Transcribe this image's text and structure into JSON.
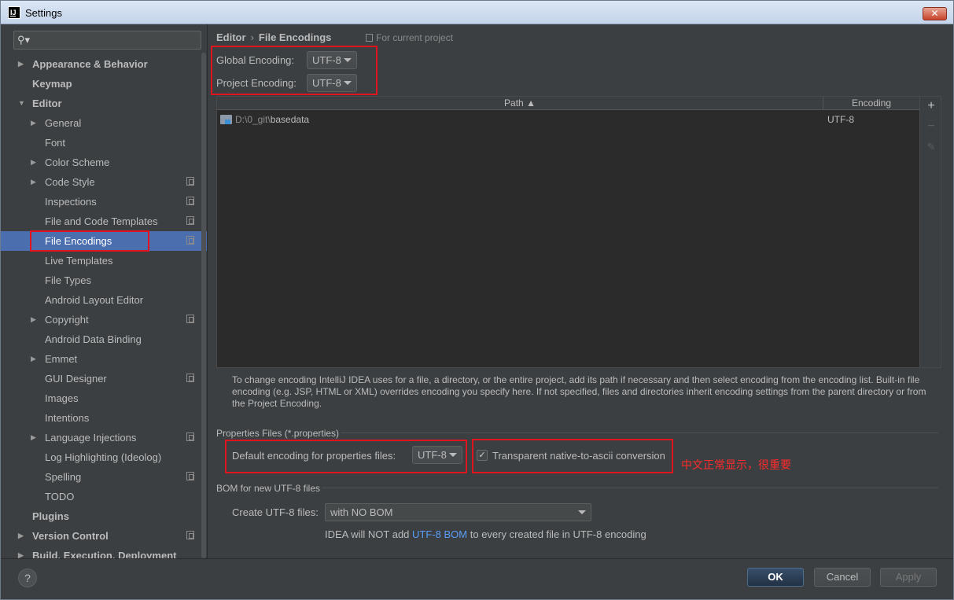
{
  "window": {
    "title": "Settings",
    "app_icon": "IJ",
    "close_icon": "✕"
  },
  "sidebar": {
    "search_placeholder": "",
    "items": [
      {
        "label": "Appearance & Behavior",
        "level": 0,
        "bold": true,
        "arrow": "right",
        "project": false
      },
      {
        "label": "Keymap",
        "level": 0,
        "bold": true,
        "arrow": "none",
        "project": false
      },
      {
        "label": "Editor",
        "level": 0,
        "bold": true,
        "arrow": "down",
        "project": false
      },
      {
        "label": "General",
        "level": 1,
        "bold": false,
        "arrow": "right",
        "project": false
      },
      {
        "label": "Font",
        "level": 1,
        "bold": false,
        "arrow": "none",
        "project": false
      },
      {
        "label": "Color Scheme",
        "level": 1,
        "bold": false,
        "arrow": "right",
        "project": false
      },
      {
        "label": "Code Style",
        "level": 1,
        "bold": false,
        "arrow": "right",
        "project": true
      },
      {
        "label": "Inspections",
        "level": 1,
        "bold": false,
        "arrow": "none",
        "project": true
      },
      {
        "label": "File and Code Templates",
        "level": 1,
        "bold": false,
        "arrow": "none",
        "project": true
      },
      {
        "label": "File Encodings",
        "level": 1,
        "bold": false,
        "arrow": "none",
        "project": true,
        "selected": true
      },
      {
        "label": "Live Templates",
        "level": 1,
        "bold": false,
        "arrow": "none",
        "project": false
      },
      {
        "label": "File Types",
        "level": 1,
        "bold": false,
        "arrow": "none",
        "project": false
      },
      {
        "label": "Android Layout Editor",
        "level": 1,
        "bold": false,
        "arrow": "none",
        "project": false
      },
      {
        "label": "Copyright",
        "level": 1,
        "bold": false,
        "arrow": "right",
        "project": true
      },
      {
        "label": "Android Data Binding",
        "level": 1,
        "bold": false,
        "arrow": "none",
        "project": false
      },
      {
        "label": "Emmet",
        "level": 1,
        "bold": false,
        "arrow": "right",
        "project": false
      },
      {
        "label": "GUI Designer",
        "level": 1,
        "bold": false,
        "arrow": "none",
        "project": true
      },
      {
        "label": "Images",
        "level": 1,
        "bold": false,
        "arrow": "none",
        "project": false
      },
      {
        "label": "Intentions",
        "level": 1,
        "bold": false,
        "arrow": "none",
        "project": false
      },
      {
        "label": "Language Injections",
        "level": 1,
        "bold": false,
        "arrow": "right",
        "project": true
      },
      {
        "label": "Log Highlighting (Ideolog)",
        "level": 1,
        "bold": false,
        "arrow": "none",
        "project": false
      },
      {
        "label": "Spelling",
        "level": 1,
        "bold": false,
        "arrow": "none",
        "project": true
      },
      {
        "label": "TODO",
        "level": 1,
        "bold": false,
        "arrow": "none",
        "project": false
      },
      {
        "label": "Plugins",
        "level": 0,
        "bold": true,
        "arrow": "none",
        "project": false
      },
      {
        "label": "Version Control",
        "level": 0,
        "bold": true,
        "arrow": "right",
        "project": true
      },
      {
        "label": "Build, Execution, Deployment",
        "level": 0,
        "bold": true,
        "arrow": "right",
        "project": false
      }
    ]
  },
  "breadcrumb": {
    "part1": "Editor",
    "sep": "›",
    "part2": "File Encodings",
    "scope": "For current project"
  },
  "encodings": {
    "global_label": "Global Encoding:",
    "global_value": "UTF-8",
    "project_label": "Project Encoding:",
    "project_value": "UTF-8"
  },
  "table": {
    "col_path": "Path ▲",
    "col_encoding": "Encoding",
    "rows": [
      {
        "path_prefix": "D:\\0_git\\",
        "path_name": "basedata",
        "encoding": "UTF-8"
      }
    ],
    "tools": {
      "add": "+",
      "remove": "−",
      "edit": "✎"
    }
  },
  "description": "To change encoding IntelliJ IDEA uses for a file, a directory, or the entire project, add its path if necessary and then select encoding from the encoding list. Built-in file encoding (e.g. JSP, HTML or XML) overrides encoding you specify here. If not specified, files and directories inherit encoding settings from the parent directory or from the Project Encoding.",
  "properties": {
    "section": "Properties Files (*.properties)",
    "default_label": "Default encoding for properties files:",
    "default_value": "UTF-8",
    "transparent_label": "Transparent native-to-ascii conversion",
    "transparent_checked": "✓"
  },
  "annotation": "中文正常显示，很重要",
  "bom": {
    "section": "BOM for new UTF-8 files",
    "create_label": "Create UTF-8 files:",
    "create_value": "with NO BOM",
    "note_pre": "IDEA will NOT add",
    "note_link": "UTF-8 BOM",
    "note_post": "to every created file in UTF-8 encoding"
  },
  "buttons": {
    "help": "?",
    "ok": "OK",
    "cancel": "Cancel",
    "apply": "Apply"
  },
  "colors": {
    "selection": "#4b6eaf",
    "annotation_red": "#e0141e",
    "link": "#589df6"
  }
}
